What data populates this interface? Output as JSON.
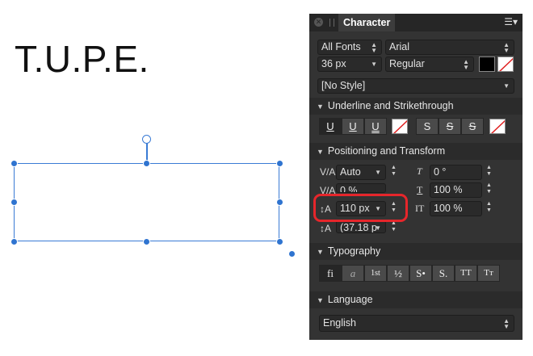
{
  "canvas": {
    "text": "T.U.P.E."
  },
  "panel": {
    "title": "Character",
    "font_collection": "All Fonts",
    "font_family": "Arial",
    "font_size": "36 px",
    "font_style": "Regular",
    "fill_color": "#000000",
    "paragraph_style": "[No Style]"
  },
  "underline_section": {
    "title": "Underline and Strikethrough",
    "underline_buttons": [
      "U",
      "U",
      "U"
    ],
    "strike_buttons": [
      "S",
      "S",
      "S"
    ]
  },
  "positioning_section": {
    "title": "Positioning and Transform",
    "tracking": "Auto",
    "kerning": "0 %",
    "leading": "110 px",
    "baseline": "(37.18 p",
    "skew": "0 °",
    "horizontal_scale": "100 %",
    "vertical_scale": "100 %"
  },
  "typography_section": {
    "title": "Typography",
    "buttons": [
      "fi",
      "a",
      "1st",
      "½",
      "S•",
      "S.",
      "TT",
      "Tт"
    ]
  },
  "language_section": {
    "title": "Language",
    "value": "English"
  },
  "colors": {
    "selection": "#3a7bd5",
    "highlight": "#e6262b",
    "panel_bg": "#333333"
  }
}
